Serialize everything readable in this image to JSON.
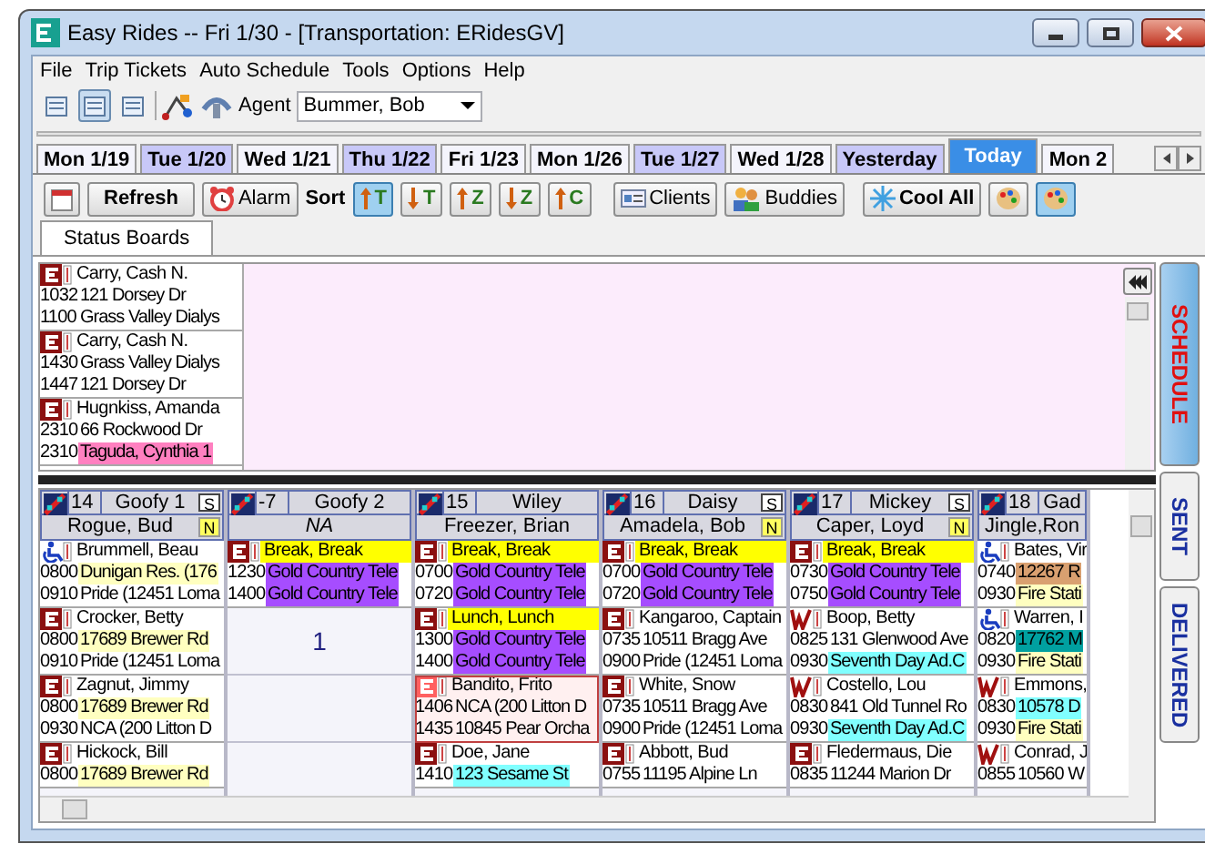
{
  "window": {
    "title": "Easy Rides -- Fri 1/30 - [Transportation: ERidesGV]"
  },
  "menu": [
    "File",
    "Trip Tickets",
    "Auto Schedule",
    "Tools",
    "Options",
    "Help"
  ],
  "toolbar": {
    "views": [
      {
        "selected": false
      },
      {
        "selected": true
      },
      {
        "selected": false
      }
    ],
    "agent_label": "Agent",
    "agent": "Bummer, Bob"
  },
  "date_tabs": [
    {
      "label": "Mon 1/19",
      "color": "#f4f4fc",
      "selected": false
    },
    {
      "label": "Tue 1/20",
      "color": "#c8c8f8",
      "selected": false
    },
    {
      "label": "Wed 1/21",
      "color": "#f4f4fc",
      "selected": false
    },
    {
      "label": "Thu 1/22",
      "color": "#c8c8f8",
      "selected": false
    },
    {
      "label": "Fri 1/23",
      "color": "#f4f4fc",
      "selected": false
    },
    {
      "label": "Mon 1/26",
      "color": "#f4f4fc",
      "selected": false
    },
    {
      "label": "Tue 1/27",
      "color": "#c8c8f8",
      "selected": false
    },
    {
      "label": "Wed 1/28",
      "color": "#f4f4fc",
      "selected": false
    },
    {
      "label": "Yesterday",
      "color": "#c8c8f8",
      "selected": false
    },
    {
      "label": "Today",
      "color": "#3a8ee6",
      "selected": true
    },
    {
      "label": "Mon 2",
      "color": "#f4f4fc",
      "selected": false
    }
  ],
  "actions": {
    "refresh": "Refresh",
    "alarm": "Alarm",
    "sort_label": "Sort",
    "sort_buttons": [
      {
        "label": "T",
        "kind": "up",
        "selected": true
      },
      {
        "label": "T",
        "kind": "down",
        "selected": false
      },
      {
        "label": "Z",
        "kind": "up",
        "selected": false
      },
      {
        "label": "Z",
        "kind": "down",
        "selected": false
      },
      {
        "label": "C",
        "kind": "up",
        "selected": false
      }
    ],
    "clients": "Clients",
    "buddies": "Buddies",
    "cool_all": "Cool All",
    "palettes": [
      {
        "selected": false
      },
      {
        "selected": true
      }
    ]
  },
  "page_tabs": [
    {
      "label": "Status Boards",
      "selected": true
    }
  ],
  "unassigned": [
    {
      "kind": "E",
      "name": "Carry, Cash N.",
      "stops": [
        {
          "time": "1032",
          "place": "121 Dorsey Dr"
        },
        {
          "time": "1100",
          "place": "Grass Valley Dialys"
        }
      ]
    },
    {
      "kind": "E",
      "name": "Carry, Cash N.",
      "stops": [
        {
          "time": "1430",
          "place": "Grass Valley Dialys"
        },
        {
          "time": "1447",
          "place": "121 Dorsey Dr"
        }
      ]
    },
    {
      "kind": "E",
      "name": "Hugnkiss, Amanda",
      "stops": [
        {
          "time": "2310",
          "place": "66 Rockwood Dr"
        },
        {
          "time": "2310",
          "place": "Taguda, Cynthia 1",
          "color": "#ff80c0"
        }
      ]
    }
  ],
  "side_tabs": [
    {
      "label": "SCHEDULE",
      "selected": true
    },
    {
      "label": "SENT",
      "selected": false
    },
    {
      "label": "DELIVERED",
      "selected": false
    }
  ],
  "vehicles": [
    {
      "number": "14",
      "name": "Goofy 1",
      "s": "S",
      "driver": "Rogue, Bud",
      "driver_italic": false,
      "n": "N",
      "trips": [
        {
          "kind": "wheelchair",
          "name": "Brummell, Beau",
          "selected": false,
          "stops": [
            {
              "time": "0800",
              "place": "Dunigan Res. (176",
              "color": "#ffffc0"
            },
            {
              "time": "0910",
              "place": "Pride (12451 Loma"
            }
          ]
        },
        {
          "kind": "E",
          "name": "Crocker, Betty",
          "selected": false,
          "stops": [
            {
              "time": "0800",
              "place": "17689 Brewer Rd",
              "color": "#ffffc0"
            },
            {
              "time": "0910",
              "place": "Pride (12451 Loma"
            }
          ]
        },
        {
          "kind": "E",
          "name": "Zagnut, Jimmy",
          "selected": false,
          "stops": [
            {
              "time": "0800",
              "place": "17689 Brewer Rd",
              "color": "#ffffc0"
            },
            {
              "time": "0930",
              "place": "NCA (200 Litton D"
            }
          ]
        },
        {
          "kind": "E",
          "name": "Hickock, Bill",
          "selected": false,
          "stops": [
            {
              "time": "0800",
              "place": "17689 Brewer Rd",
              "color": "#ffffc0"
            }
          ]
        }
      ]
    },
    {
      "number": "-7",
      "name": "Goofy 2",
      "driver": "NA",
      "driver_italic": true,
      "count": "1",
      "trips": [
        {
          "kind": "E",
          "name": "Break, Break",
          "color": "#ffff00",
          "selected": false,
          "stops": [
            {
              "time": "1230",
              "place": "Gold Country Tele",
              "color": "#a64dff"
            },
            {
              "time": "1400",
              "place": "Gold Country Tele",
              "color": "#a64dff"
            }
          ]
        }
      ]
    },
    {
      "number": "15",
      "name": "Wiley",
      "driver": "Freezer, Brian",
      "driver_italic": false,
      "trips": [
        {
          "kind": "E",
          "name": "Break, Break",
          "color": "#ffff00",
          "selected": false,
          "stops": [
            {
              "time": "0700",
              "place": "Gold Country Tele",
              "color": "#a64dff"
            },
            {
              "time": "0720",
              "place": "Gold Country Tele",
              "color": "#a64dff"
            }
          ]
        },
        {
          "kind": "E",
          "name": "Lunch, Lunch",
          "color": "#ffff00",
          "selected": false,
          "stops": [
            {
              "time": "1300",
              "place": "Gold Country Tele",
              "color": "#a64dff"
            },
            {
              "time": "1400",
              "place": "Gold Country Tele",
              "color": "#a64dff"
            }
          ]
        },
        {
          "kind": "E",
          "name": "Bandito, Frito",
          "selected": true,
          "stops": [
            {
              "time": "1406",
              "place": "NCA (200 Litton D"
            },
            {
              "time": "1435",
              "place": "10845 Pear Orcha"
            }
          ]
        },
        {
          "kind": "E",
          "name": "Doe, Jane",
          "selected": false,
          "stops": [
            {
              "time": "1410",
              "place": "123 Sesame St",
              "color": "#80ffff"
            }
          ]
        }
      ]
    },
    {
      "number": "16",
      "name": "Daisy",
      "s": "S",
      "driver": "Amadela, Bob",
      "driver_italic": false,
      "n": "N",
      "trips": [
        {
          "kind": "E",
          "name": "Break, Break",
          "color": "#ffff00",
          "selected": false,
          "stops": [
            {
              "time": "0700",
              "place": "Gold Country Tele",
              "color": "#a64dff"
            },
            {
              "time": "0720",
              "place": "Gold Country Tele",
              "color": "#a64dff"
            }
          ]
        },
        {
          "kind": "E",
          "name": "Kangaroo, Captain",
          "selected": false,
          "stops": [
            {
              "time": "0735",
              "place": "10511 Bragg Ave"
            },
            {
              "time": "0900",
              "place": "Pride (12451 Loma"
            }
          ]
        },
        {
          "kind": "E",
          "name": "White, Snow",
          "selected": false,
          "stops": [
            {
              "time": "0735",
              "place": "10511 Bragg Ave"
            },
            {
              "time": "0900",
              "place": "Pride (12451 Loma"
            }
          ]
        },
        {
          "kind": "E",
          "name": "Abbott, Bud",
          "selected": false,
          "stops": [
            {
              "time": "0755",
              "place": "11195 Alpine Ln"
            }
          ]
        }
      ]
    },
    {
      "number": "17",
      "name": "Mickey",
      "s": "S",
      "driver": "Caper, Loyd",
      "driver_italic": false,
      "n": "N",
      "trips": [
        {
          "kind": "E",
          "name": "Break, Break",
          "color": "#ffff00",
          "selected": false,
          "stops": [
            {
              "time": "0730",
              "place": "Gold Country Tele",
              "color": "#a64dff"
            },
            {
              "time": "0750",
              "place": "Gold Country Tele",
              "color": "#a64dff"
            }
          ]
        },
        {
          "kind": "W",
          "name": "Boop, Betty",
          "selected": false,
          "stops": [
            {
              "time": "0825",
              "place": "131 Glenwood Ave"
            },
            {
              "time": "0930",
              "place": "Seventh Day Ad.C",
              "color": "#80ffff"
            }
          ]
        },
        {
          "kind": "W",
          "name": "Costello, Lou",
          "selected": false,
          "stops": [
            {
              "time": "0830",
              "place": "841 Old Tunnel Ro"
            },
            {
              "time": "0930",
              "place": "Seventh Day Ad.C",
              "color": "#80ffff"
            }
          ]
        },
        {
          "kind": "E",
          "name": "Fledermaus, Die",
          "selected": false,
          "stops": [
            {
              "time": "0835",
              "place": "11244 Marion Dr"
            }
          ]
        }
      ]
    },
    {
      "number": "18",
      "name": "Gad",
      "driver": "Jingle,Ron",
      "driver_italic": false,
      "trips": [
        {
          "kind": "wheelchair",
          "name": "Bates, Vir",
          "selected": false,
          "stops": [
            {
              "time": "0740",
              "place": "12267 R",
              "color": "#d9a070"
            },
            {
              "time": "0930",
              "place": "Fire Stati",
              "color": "#ffffc0"
            }
          ]
        },
        {
          "kind": "wheelchair",
          "name": "Warren, I",
          "selected": false,
          "stops": [
            {
              "time": "0820",
              "place": "17762 M",
              "color": "#00a0a0"
            },
            {
              "time": "0930",
              "place": "Fire Stati",
              "color": "#ffffc0"
            }
          ]
        },
        {
          "kind": "W",
          "name": "Emmons,",
          "selected": false,
          "stops": [
            {
              "time": "0830",
              "place": "10578 D",
              "color": "#80ffff"
            },
            {
              "time": "0930",
              "place": "Fire Stati",
              "color": "#ffffc0"
            }
          ]
        },
        {
          "kind": "W",
          "name": "Conrad, J",
          "selected": false,
          "stops": [
            {
              "time": "0855",
              "place": "10560 W"
            }
          ]
        }
      ]
    }
  ]
}
